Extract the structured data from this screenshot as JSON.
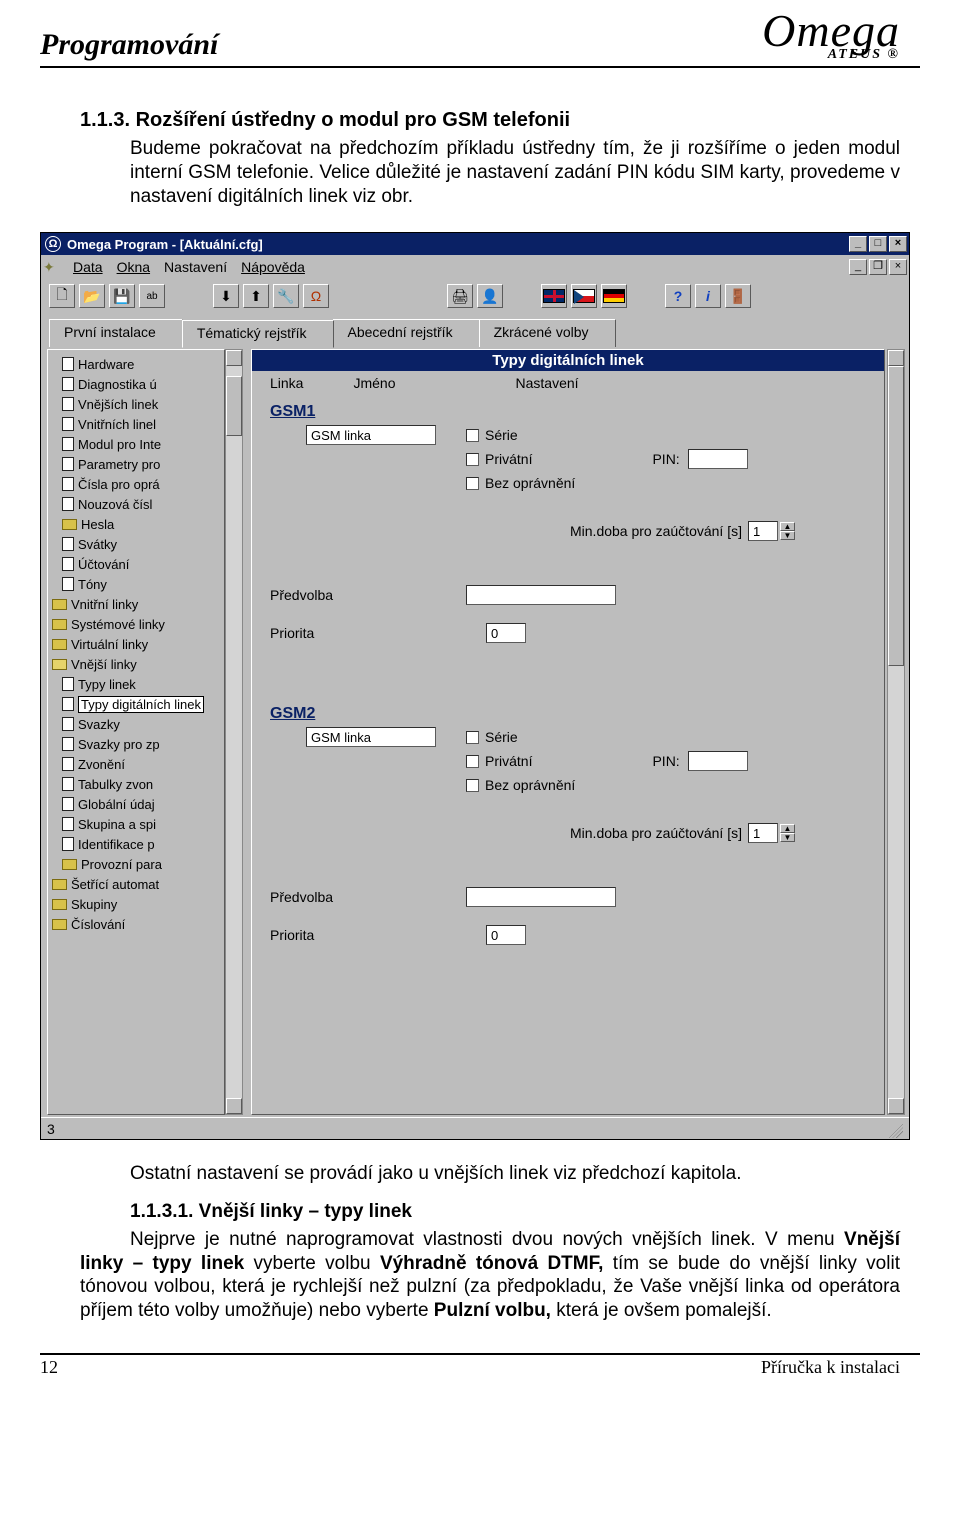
{
  "header": {
    "title": "Programování",
    "brand_main": "Omega",
    "brand_sub": "ATEUS ®"
  },
  "section": {
    "num_title": "1.1.3.  Rozšíření ústředny o modul pro GSM telefonii",
    "para1": "Budeme pokračovat na předchozím příkladu ústředny tím, že ji rozšíříme o jeden modul interní GSM telefonie. Velice důležité je nastavení zadání PIN kódu SIM karty, provedeme v nastavení digitálních linek viz obr."
  },
  "win": {
    "title": "Omega Program - [Aktuální.cfg]",
    "menu": {
      "data": "Data",
      "okna": "Okna",
      "nastaveni": "Nastavení",
      "napoveda": "Nápověda"
    },
    "tabs": {
      "t1": "První instalace",
      "t2": "Tématický rejstřík",
      "t3": "Abecední rejstřík",
      "t4": "Zkrácené volby"
    },
    "panel_title": "Typy digitálních linek",
    "colhead": {
      "linka": "Linka",
      "jmeno": "Jméno",
      "nastaveni": "Nastavení"
    },
    "tree": {
      "hardware": "Hardware",
      "diag": "Diagnostika ú",
      "vnejsich": "Vnějších linek",
      "vnitrnich": "Vnitřních linel",
      "modul": "Modul pro Inte",
      "param": "Parametry pro",
      "cisla": "Čísla pro oprá",
      "nouz": "Nouzová čísl",
      "hesla": "Hesla",
      "svatky": "Svátky",
      "ucto": "Účtování",
      "tony": "Tóny",
      "vnitrni_linky": "Vnitřní linky",
      "systemove": "Systémové linky",
      "virtualni": "Virtuální linky",
      "vnejsi_linky": "Vnější linky",
      "typy_linek": "Typy linek",
      "typy_dig": "Typy digitálních linek",
      "svazky": "Svazky",
      "svazky_zp": "Svazky pro zp",
      "zvoneni": "Zvonění",
      "tabulky": "Tabulky zvon",
      "global": "Globální údaj",
      "skupina": "Skupina a spi",
      "ident": "Identifikace p",
      "provoz": "Provozní para",
      "setrici": "Šetřící automat",
      "skupiny": "Skupiny",
      "cislovani": "Číslování"
    },
    "gsm": {
      "g1": "GSM1",
      "g2": "GSM2",
      "linka_val": "GSM linka",
      "serie": "Série",
      "privatni": "Privátní",
      "bezop": "Bez oprávnění",
      "pin": "PIN:",
      "mindoba": "Min.doba pro zaúčtování [s]",
      "mindoba_val": "1",
      "predvolba": "Předvolba",
      "priorita": "Priorita",
      "priorita_val": "0"
    },
    "status": "3"
  },
  "post": {
    "p1": "Ostatní nastavení se provádí jako u vnějších linek viz předchozí kapitola.",
    "sub_title": "1.1.3.1. Vnější linky – typy linek",
    "p2a": "Nejprve je nutné naprogramovat vlastnosti dvou nových vnějších linek. V menu ",
    "p2b": "Vnější linky – typy linek",
    "p2c": " vyberte volbu ",
    "p2d": "Výhradně tónová DTMF,",
    "p2e": " tím se bude do vnější linky volit tónovou volbou, která je rychlejší než pulzní (za předpokladu, že Vaše vnější linka od operátora příjem této volby umožňuje) nebo vyberte ",
    "p2f": "Pulzní volbu,",
    "p2g": " která je ovšem pomalejší."
  },
  "footer": {
    "page": "12",
    "book": "Příručka k instalaci"
  }
}
